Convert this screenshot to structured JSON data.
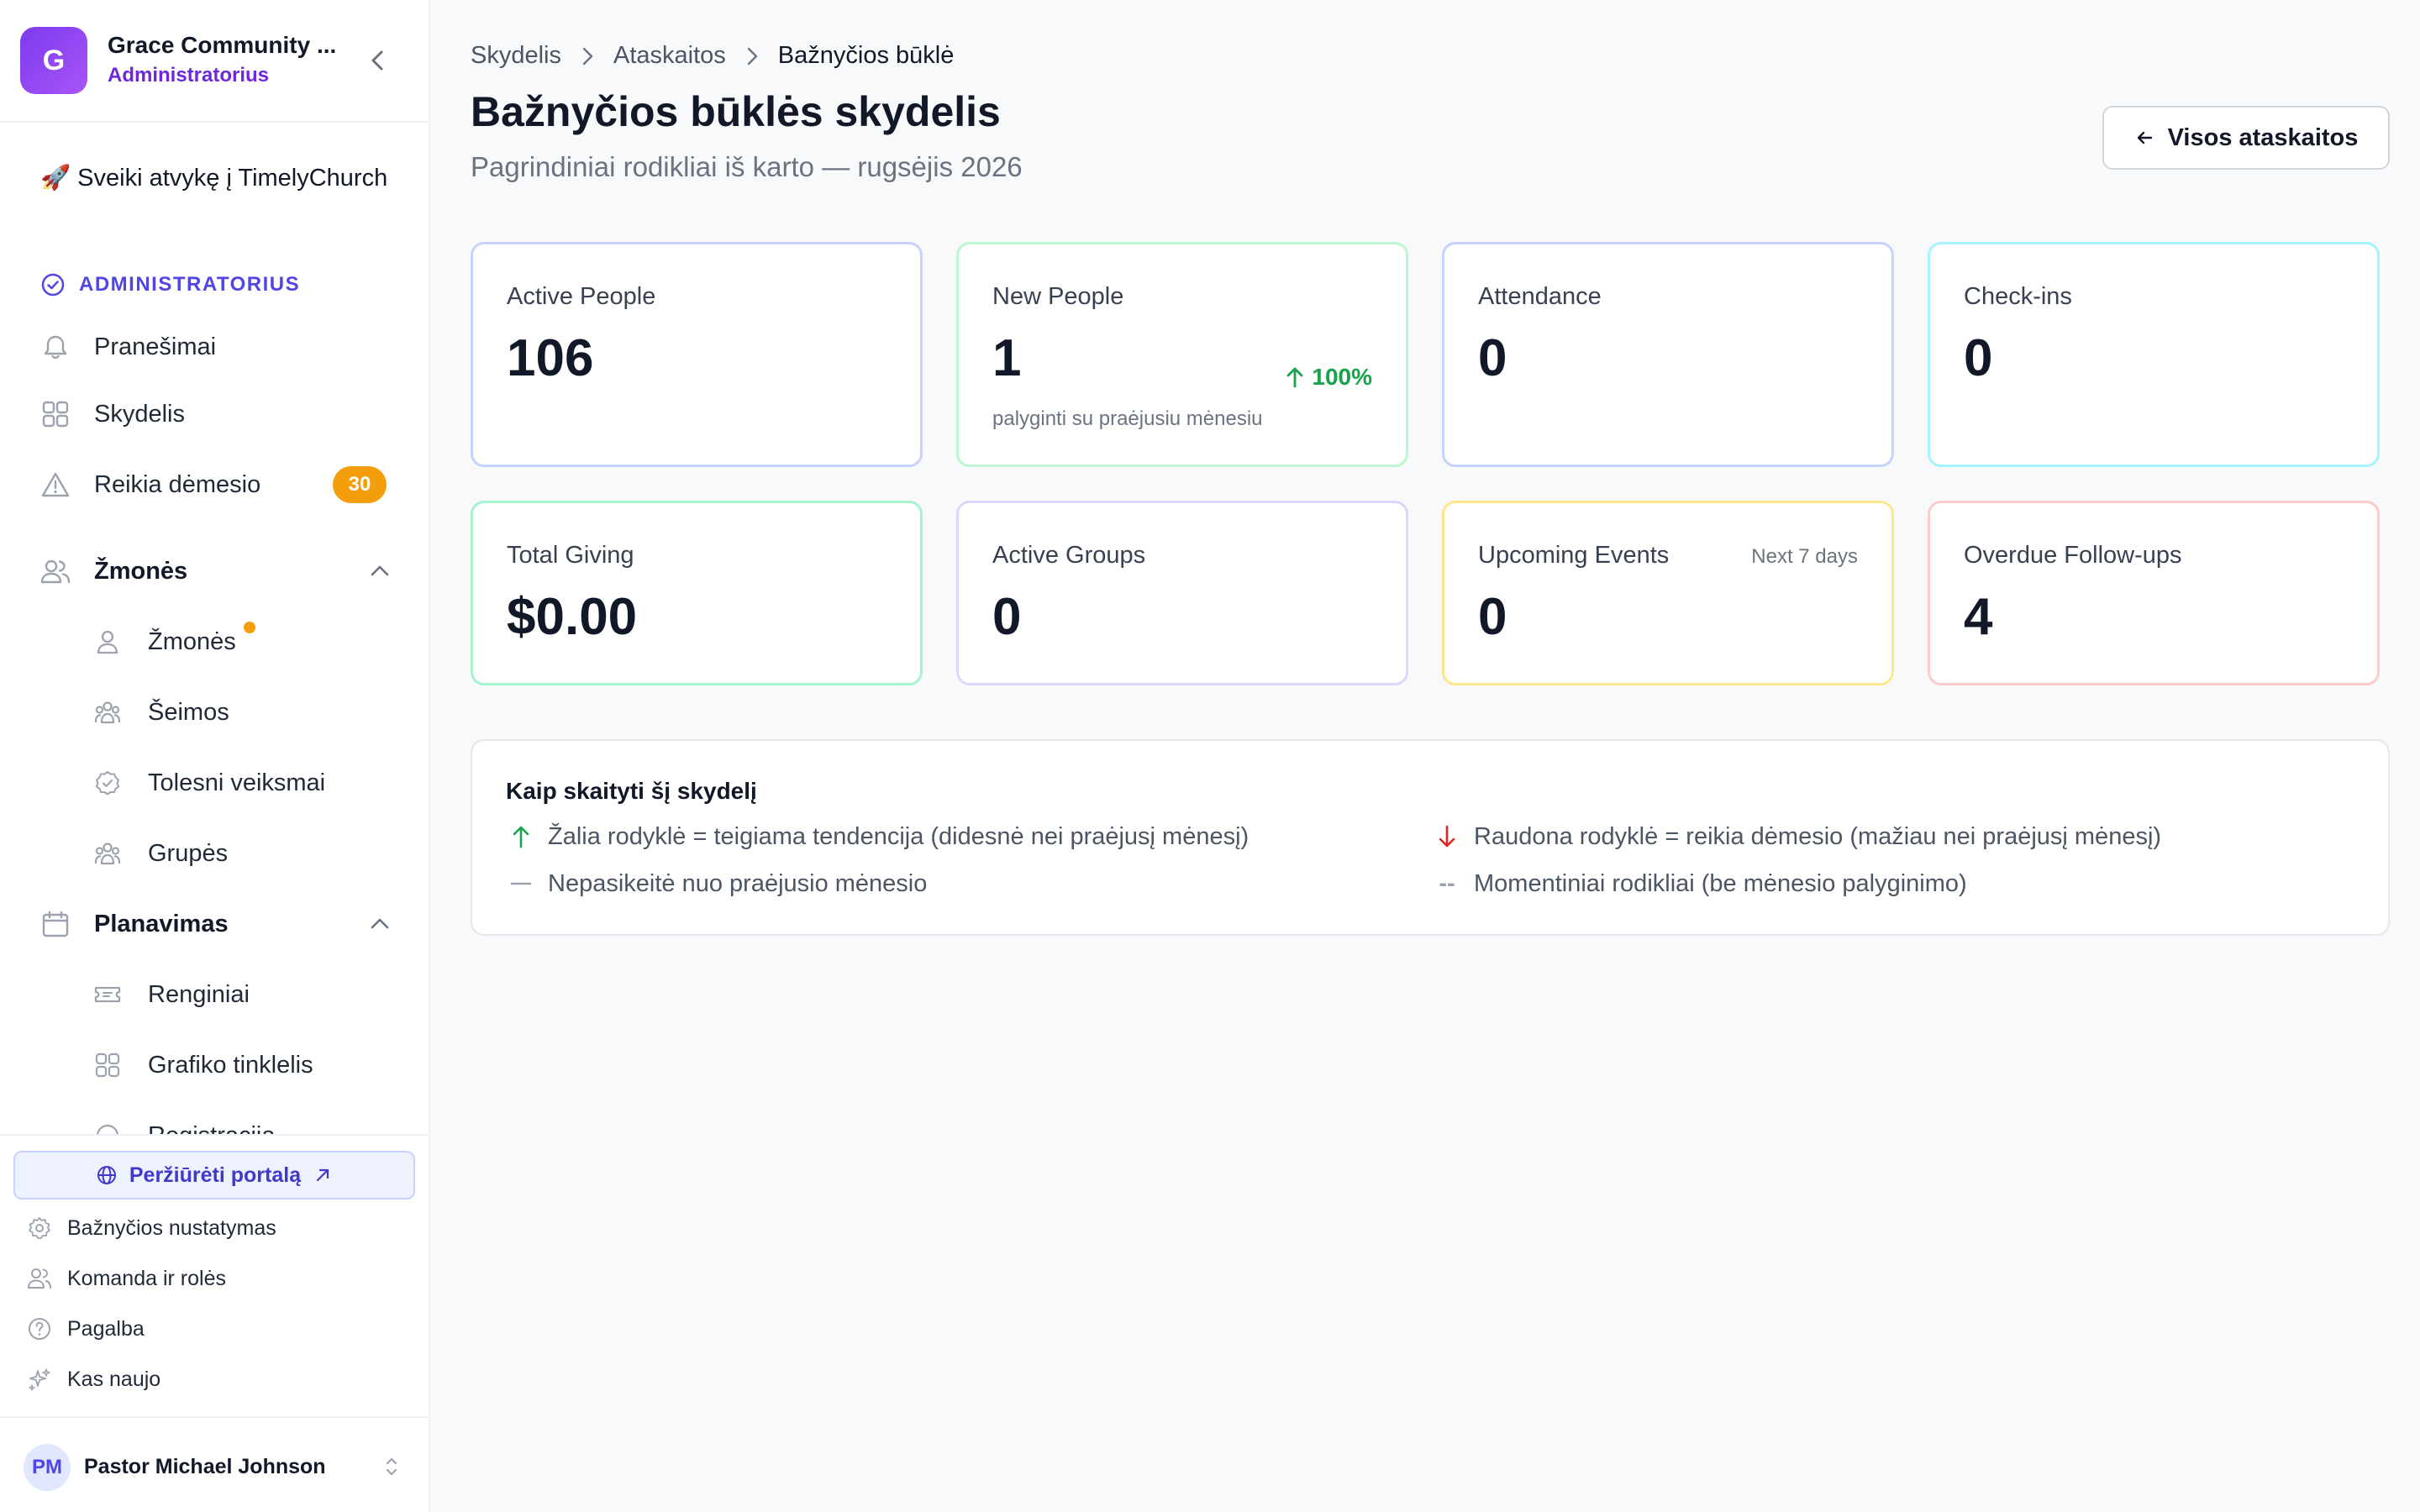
{
  "sidebar": {
    "org": {
      "initial": "G",
      "name": "Grace Community ...",
      "role": "Administratorius"
    },
    "welcome": "🚀 Sveiki atvykę į TimelyChurch",
    "section_label": "ADMINISTRATORIUS",
    "items": {
      "notifications": {
        "label": "Pranešimai",
        "icon": "bell-icon"
      },
      "dashboard": {
        "label": "Skydelis",
        "icon": "grid-icon"
      },
      "attention": {
        "label": "Reikia dėmesio",
        "icon": "warning-icon",
        "badge": "30"
      }
    },
    "people_group": {
      "label": "Žmonės",
      "children": {
        "people": {
          "label": "Žmonės"
        },
        "families": {
          "label": "Šeimos"
        },
        "followups": {
          "label": "Tolesni veiksmai"
        },
        "groups": {
          "label": "Grupės"
        }
      }
    },
    "planning_group": {
      "label": "Planavimas",
      "children": {
        "events": {
          "label": "Renginiai"
        },
        "schedule": {
          "label": "Grafiko tinklelis"
        },
        "registrations": {
          "label": "Registracija"
        }
      }
    },
    "footer": {
      "portal": "Peržiūrėti portalą",
      "settings": "Bažnyčios nustatymas",
      "team": "Komanda ir rolės",
      "help": "Pagalba",
      "whats_new": "Kas naujo"
    },
    "user": {
      "initials": "PM",
      "name": "Pastor Michael Johnson"
    }
  },
  "main": {
    "breadcrumb": [
      "Skydelis",
      "Ataskaitos",
      "Bažnyčios būklė"
    ],
    "title": "Bažnyčios būklės skydelis",
    "subtitle": "Pagrindiniai rodikliai iš karto — rugsėjis 2026",
    "all_reports_button": "Visos ataskaitos",
    "cards": {
      "active_people": {
        "label": "Active People",
        "value": "106",
        "border": "#c7d2fe"
      },
      "new_people": {
        "label": "New People",
        "value": "1",
        "trend": "100%",
        "note": "palyginti su praėjusiu mėnesiu",
        "border": "#bbf7d0"
      },
      "attendance": {
        "label": "Attendance",
        "value": "0",
        "border": "#c7d2fe"
      },
      "checkins": {
        "label": "Check-ins",
        "value": "0",
        "border": "#a5f3fc"
      },
      "total_giving": {
        "label": "Total Giving",
        "value": "$0.00",
        "border": "#a7f3d0"
      },
      "active_groups": {
        "label": "Active Groups",
        "value": "0",
        "border": "#ddd6fe"
      },
      "upcoming_events": {
        "label": "Upcoming Events",
        "value": "0",
        "hint": "Next 7 days",
        "border": "#fde68a"
      },
      "overdue_followups": {
        "label": "Overdue Follow-ups",
        "value": "4",
        "border": "#fecaca"
      }
    },
    "legend": {
      "title": "Kaip skaityti šį skydelį",
      "green": "Žalia rodyklė = teigiama tendencija (didesnė nei praėjusį mėnesį)",
      "red": "Raudona rodyklė = reikia dėmesio (mažiau nei praėjusį mėnesį)",
      "unchanged": "Nepasikeitė nuo praėjusio mėnesio",
      "snapshot_marker": "--",
      "snapshot": "Momentiniai rodikliai (be mėnesio palyginimo)"
    }
  },
  "colors": {
    "accent": "#4f46e5",
    "brand_gradient_start": "#7c3aed",
    "badge": "#f59e0b",
    "positive": "#16a34a",
    "negative": "#dc2626"
  }
}
